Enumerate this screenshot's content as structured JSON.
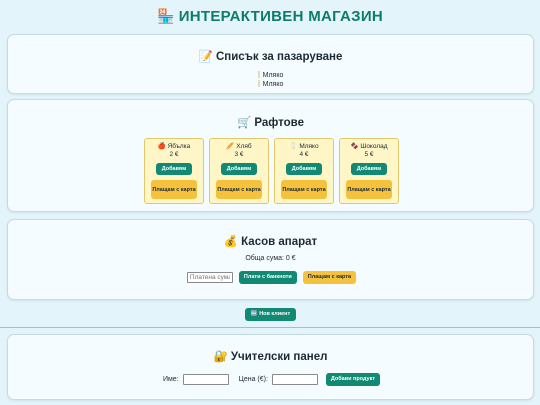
{
  "header": {
    "icon": "🏪",
    "title": "ИНТЕРАКТИВЕН МАГАЗИН"
  },
  "shopping_list": {
    "icon": "📝",
    "title": "Списък за пазаруване",
    "items": [
      "Мляко",
      "Мляко"
    ]
  },
  "shelves": {
    "icon": "🛒",
    "title": "Рафтове",
    "add_label": "Добавям",
    "card_label": "Плащам с карта",
    "products": [
      {
        "emoji": "🍎",
        "name": "Ябълка",
        "price": "2 €"
      },
      {
        "emoji": "🥖",
        "name": "Хляб",
        "price": "3 €"
      },
      {
        "emoji": "🥛",
        "name": "Мляко",
        "price": "4 €"
      },
      {
        "emoji": "🍫",
        "name": "Шоколад",
        "price": "5 €"
      }
    ]
  },
  "register": {
    "icon": "💰",
    "title": "Касов апарат",
    "total_label": "Обща сума: 0 €",
    "paid_placeholder": "Платена сума",
    "cash_button": "Плати с банкноти",
    "card_button": "Плащам с карта"
  },
  "new_client": {
    "icon": "🆕",
    "label": "Нов клиент"
  },
  "teacher": {
    "icon": "🔐",
    "title": "Учителски панел",
    "name_label": "Име:",
    "price_label": "Цена (€):",
    "add_product_button": "Добави продукт"
  },
  "colors": {
    "accent": "#128a73",
    "title": "#0e7c6b",
    "warning": "#f4c23d",
    "product_bg": "#fff6c8"
  }
}
